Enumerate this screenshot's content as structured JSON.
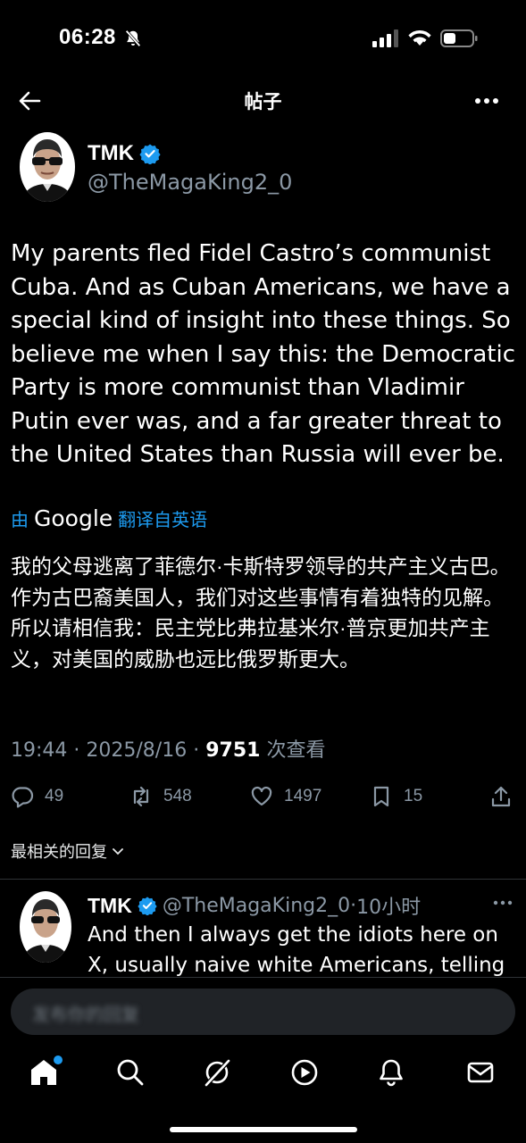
{
  "status_bar": {
    "time": "06:28"
  },
  "header": {
    "title": "帖子"
  },
  "post": {
    "author_name": "TMK",
    "author_handle": "@TheMagaKing2_0",
    "text": "My parents fled Fidel Castro’s communist Cuba. And as Cuban Americans, we have a special kind of insight into these things. So believe me when I say this: the Democratic Party is more communist than Vladimir Putin ever was, and a far greater threat to the United States than Russia will ever be.",
    "translate_by": "由",
    "translate_brand": "Google",
    "translate_label": "翻译自英语",
    "translation": "我的父母逃离了菲德尔·卡斯特罗领导的共产主义古巴。作为古巴裔美国人，我们对这些事情有着独特的见解。所以请相信我：民主党比弗拉基米尔·普京更加共产主义，对美国的威胁也远比俄罗斯更大。",
    "time": "19:44",
    "date": "2025/8/16",
    "views": "9751",
    "views_label": "次查看",
    "replies": "49",
    "reposts": "548",
    "likes": "1497",
    "bookmarks": "15"
  },
  "sort_label": "最相关的回复",
  "reply": {
    "author_name": "TMK",
    "author_handle": "@TheMagaKing2_0",
    "age": "10小时",
    "text": "And then I always get the idiots here on X, usually naive white Americans, telling me,"
  },
  "compose": {
    "placeholder": "发布你的回复"
  },
  "colors": {
    "accent": "#1d9bf0",
    "muted": "#8b98a5",
    "background": "#000000"
  },
  "tabs": [
    {
      "name": "home-tab",
      "icon": "home-icon"
    },
    {
      "name": "search-tab",
      "icon": "search-icon"
    },
    {
      "name": "grok-tab",
      "icon": "grok-icon"
    },
    {
      "name": "video-tab",
      "icon": "play-icon"
    },
    {
      "name": "notifications-tab",
      "icon": "bell-icon"
    },
    {
      "name": "messages-tab",
      "icon": "mail-icon"
    }
  ]
}
